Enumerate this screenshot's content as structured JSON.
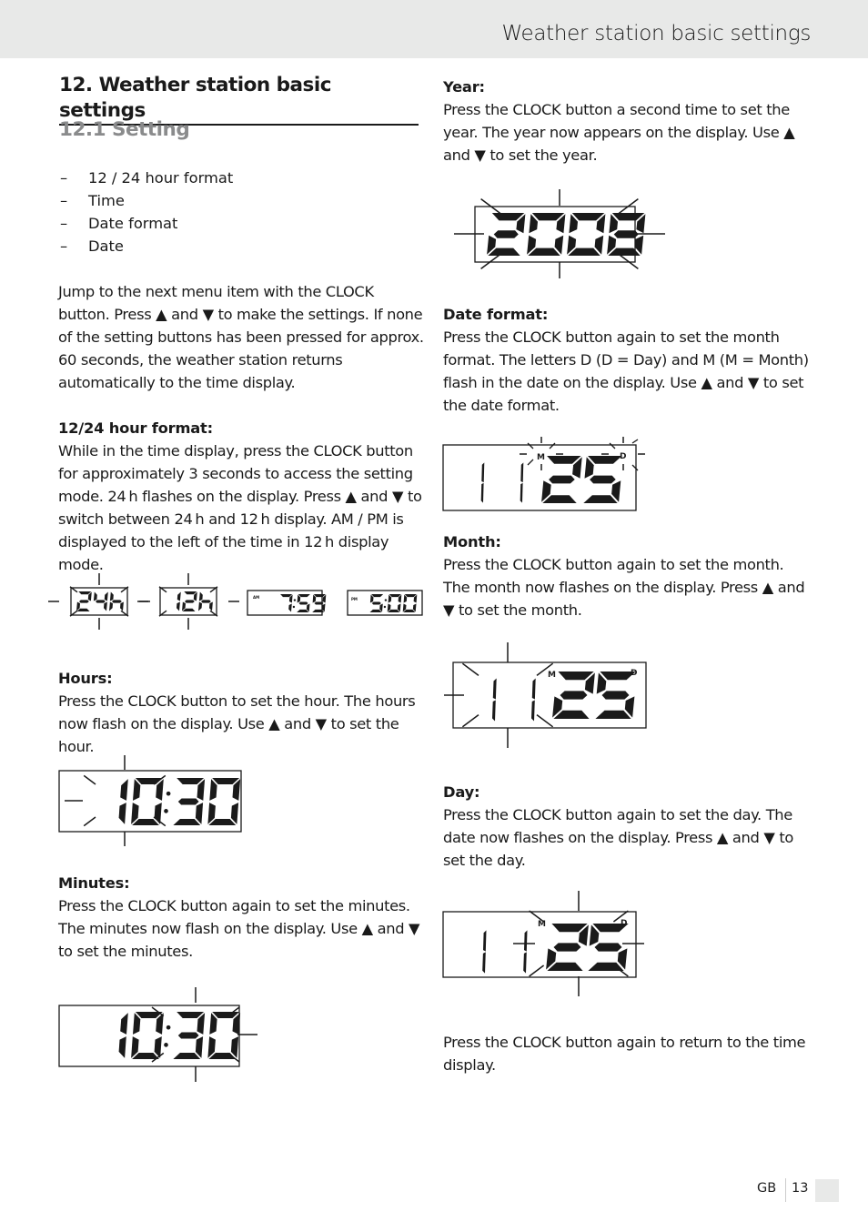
{
  "header": {
    "title": "Weather station basic settings"
  },
  "section": {
    "title": "12. Weather station basic settings",
    "subtitle": "12.1 Setting",
    "list_items": [
      "12 / 24 hour format",
      "Time",
      "Date format",
      "Date"
    ],
    "intro": "Jump to the next menu item with the CLOCK button. Press ▲ and ▼ to make the settings. If none of the setting buttons has been pressed for approx. 60 seconds, the weather station returns automatically to the time display."
  },
  "hour_format": {
    "heading": "12/24 hour format:",
    "text": "While in the time display, press the CLOCK button for approximately 3 seconds to access the setting mode. 24 h flashes on the display. Press ▲ and ▼ to switch between 24 h and 12 h display. AM / PM is displayed to the left of the time in 12 h display mode."
  },
  "hours": {
    "heading": "Hours:",
    "text": "Press the CLOCK button to set the hour. The hours now flash on the display. Use ▲ and ▼ to set the hour."
  },
  "minutes": {
    "heading": "Minutes:",
    "text": "Press the CLOCK button again to set the minutes. The minutes now flash on the display. Use ▲ and ▼ to set the minutes."
  },
  "year": {
    "heading": "Year:",
    "text": "Press the CLOCK button a second time to set the year. The year now appears on the display. Use ▲ and ▼ to set the year."
  },
  "date_format": {
    "heading": "Date format:",
    "text": "Press the CLOCK button again to set the month format. The letters D (D = Day) and M (M = Month) flash in the date on the display. Use ▲ and ▼ to set the date format."
  },
  "month": {
    "heading": "Month:",
    "text": "Press the CLOCK button again to set the month. The month now flashes on the display. Press ▲ and ▼ to set the month."
  },
  "day": {
    "heading": "Day:",
    "text": "Press the CLOCK button again to set the day. The date now flashes on the display. Press ▲ and ▼ to set the day."
  },
  "closing": {
    "text": "Press the CLOCK button again to return to the time display."
  },
  "displays": {
    "d24h": {
      "text": "24h",
      "flashing": true
    },
    "d12h": {
      "text": "12h",
      "flashing": true
    },
    "am": {
      "indicator": "AM",
      "text": "7:59"
    },
    "pm": {
      "indicator": "PM",
      "text": "5:00"
    },
    "hours": {
      "text": "10:30",
      "flashing": "hours"
    },
    "minutes": {
      "text": "10:30",
      "flashing": "minutes"
    },
    "year": {
      "text": "2008",
      "flashing": true
    },
    "date_format": {
      "text": "1125",
      "month_label": "M",
      "day_label": "D",
      "flashing": "labels"
    },
    "month": {
      "text": "1125",
      "month_label": "M",
      "day_label": "D",
      "flashing": "month"
    },
    "day": {
      "text": "1125",
      "month_label": "M",
      "day_label": "D",
      "flashing": "day"
    }
  },
  "footer": {
    "language": "GB",
    "page": "13"
  }
}
